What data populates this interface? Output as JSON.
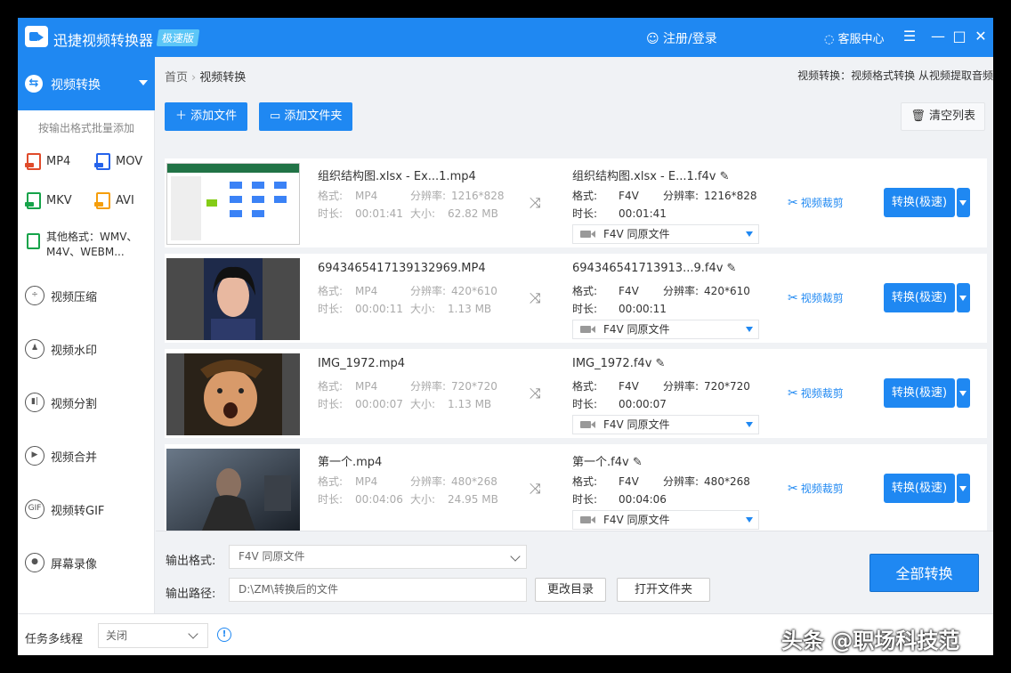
{
  "app": {
    "title": "迅捷视频转换器",
    "badge": "极速版",
    "login": "注册/登录",
    "service": "客服中心"
  },
  "sidebar": {
    "active": "视频转换",
    "hint": "按输出格式批量添加",
    "formats": [
      "MP4",
      "MOV",
      "MKV",
      "AVI"
    ],
    "other": "其他格式：WMV、M4V、WEBM...",
    "items": [
      {
        "label": "视频压缩",
        "icon": "compress-icon"
      },
      {
        "label": "视频水印",
        "icon": "watermark-icon"
      },
      {
        "label": "视频分割",
        "icon": "split-icon"
      },
      {
        "label": "视频合并",
        "icon": "merge-icon"
      },
      {
        "label": "视频转GIF",
        "icon": "gif-icon"
      },
      {
        "label": "屏幕录像",
        "icon": "record-icon"
      }
    ]
  },
  "breadcrumb": {
    "home": "首页",
    "current": "视频转换"
  },
  "top_desc": "视频转换：视频格式转换 从视频提取音频",
  "toolbar": {
    "add_file": "添加文件",
    "add_folder": "添加文件夹",
    "clear": "清空列表"
  },
  "labels": {
    "format": "格式:",
    "resolution": "分辨率:",
    "duration": "时长:",
    "size": "大小:",
    "trim": "视频裁剪",
    "convert": "转换(极速)"
  },
  "files": [
    {
      "name": "组织结构图.xlsx - Ex...1.mp4",
      "format": "MP4",
      "resolution": "1216*828",
      "duration": "00:01:41",
      "size": "62.82 MB",
      "out_name": "组织结构图.xlsx - E...1.f4v",
      "out_format": "F4V",
      "out_resolution": "1216*828",
      "out_duration": "00:01:41",
      "out_preset": "F4V   同原文件"
    },
    {
      "name": "6943465417139132969.MP4",
      "format": "MP4",
      "resolution": "420*610",
      "duration": "00:00:11",
      "size": "1.13 MB",
      "out_name": "694346541713913...9.f4v",
      "out_format": "F4V",
      "out_resolution": "420*610",
      "out_duration": "00:00:11",
      "out_preset": "F4V   同原文件"
    },
    {
      "name": "IMG_1972.mp4",
      "format": "MP4",
      "resolution": "720*720",
      "duration": "00:00:07",
      "size": "1.13 MB",
      "out_name": "IMG_1972.f4v",
      "out_format": "F4V",
      "out_resolution": "720*720",
      "out_duration": "00:00:07",
      "out_preset": "F4V   同原文件"
    },
    {
      "name": "第一个.mp4",
      "format": "MP4",
      "resolution": "480*268",
      "duration": "00:04:06",
      "size": "24.95 MB",
      "out_name": "第一个.f4v",
      "out_format": "F4V",
      "out_resolution": "480*268",
      "out_duration": "00:04:06",
      "out_preset": "F4V   同原文件"
    }
  ],
  "bottom": {
    "format_label": "输出格式:",
    "format_value": "F4V   同原文件",
    "path_label": "输出路径:",
    "path_value": "D:\\ZM\\转换后的文件",
    "change_dir": "更改目录",
    "open_folder": "打开文件夹",
    "convert_all": "全部转换"
  },
  "status": {
    "label": "任务多线程",
    "value": "关闭"
  },
  "watermark": "头条 @职场科技范"
}
